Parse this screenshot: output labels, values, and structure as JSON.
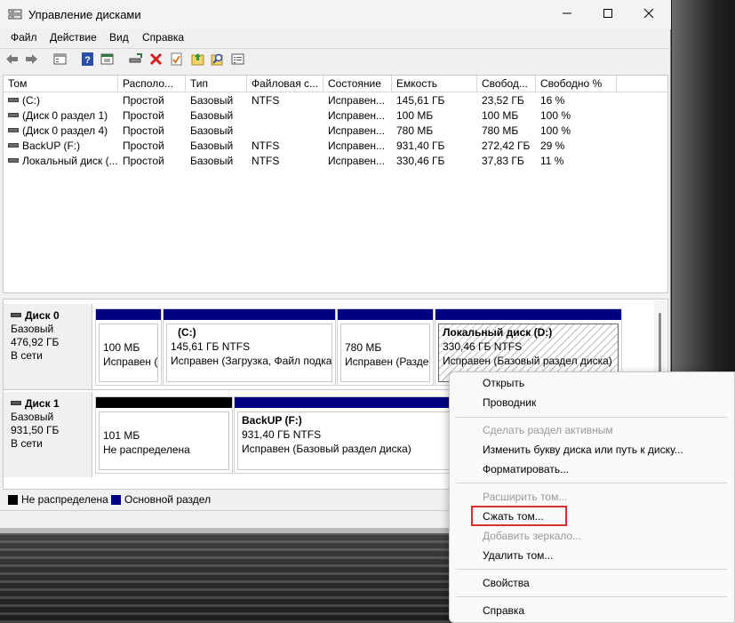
{
  "window": {
    "title": "Управление дисками",
    "controls": {
      "minimize": "—",
      "maximize": "☐",
      "close": "✕"
    }
  },
  "menu": [
    "Файл",
    "Действие",
    "Вид",
    "Справка"
  ],
  "toolbar": [
    "back-icon",
    "forward-icon",
    "properties-icon",
    "help-icon",
    "console-icon",
    "connect-icon",
    "delete-icon",
    "check-icon",
    "import-icon",
    "search-icon",
    "list-icon"
  ],
  "table": {
    "columns": [
      "Том",
      "Располо...",
      "Тип",
      "Файловая с...",
      "Состояние",
      "Емкость",
      "Свобод...",
      "Свободно %"
    ],
    "rows": [
      [
        "(C:)",
        "Простой",
        "Базовый",
        "NTFS",
        "Исправен...",
        "145,61 ГБ",
        "23,52 ГБ",
        "16 %"
      ],
      [
        "(Диск 0 раздел 1)",
        "Простой",
        "Базовый",
        "",
        "Исправен...",
        "100 МБ",
        "100 МБ",
        "100 %"
      ],
      [
        "(Диск 0 раздел 4)",
        "Простой",
        "Базовый",
        "",
        "Исправен...",
        "780 МБ",
        "780 МБ",
        "100 %"
      ],
      [
        "BackUP (F:)",
        "Простой",
        "Базовый",
        "NTFS",
        "Исправен...",
        "931,40 ГБ",
        "272,42 ГБ",
        "29 %"
      ],
      [
        "Локальный диск (...",
        "Простой",
        "Базовый",
        "NTFS",
        "Исправен...",
        "330,46 ГБ",
        "37,83 ГБ",
        "11 %"
      ]
    ]
  },
  "disks": [
    {
      "name": "Диск 0",
      "type": "Базовый",
      "size": "476,92 ГБ",
      "status": "В сети",
      "partitions": [
        {
          "title": "",
          "line1": "100 МБ",
          "line2": "Исправен (",
          "kind": "primary"
        },
        {
          "title": "(C:)",
          "line1": "145,61 ГБ NTFS",
          "line2": "Исправен (Загрузка, Файл подка",
          "kind": "primary"
        },
        {
          "title": "",
          "line1": "780 МБ",
          "line2": "Исправен (Разде",
          "kind": "primary"
        },
        {
          "title": "Локальный диск  (D:)",
          "line1": "330,46 ГБ NTFS",
          "line2": "Исправен (Базовый раздел диска)",
          "kind": "primary-selected"
        }
      ]
    },
    {
      "name": "Диск 1",
      "type": "Базовый",
      "size": "931,50 ГБ",
      "status": "В сети",
      "partitions": [
        {
          "title": "",
          "line1": "101 МБ",
          "line2": "Не распределена",
          "kind": "unallocated"
        },
        {
          "title": "BackUP  (F:)",
          "line1": "931,40 ГБ NTFS",
          "line2": "Исправен (Базовый раздел диска)",
          "kind": "primary"
        }
      ]
    }
  ],
  "legend": [
    {
      "label": "Не распределена",
      "color": "#000000"
    },
    {
      "label": "Основной раздел",
      "color": "#000080"
    }
  ],
  "context_menu": {
    "items": [
      {
        "label": "Открыть",
        "enabled": true
      },
      {
        "label": "Проводник",
        "enabled": true
      },
      {
        "label": "Сделать раздел активным",
        "enabled": false
      },
      {
        "label": "Изменить букву диска или путь к диску...",
        "enabled": true
      },
      {
        "label": "Форматировать...",
        "enabled": true
      },
      {
        "label": "Расширить том...",
        "enabled": false
      },
      {
        "label": "Сжать том...",
        "enabled": true,
        "highlighted": true
      },
      {
        "label": "Добавить зеркало...",
        "enabled": false
      },
      {
        "label": "Удалить том...",
        "enabled": true
      },
      {
        "label": "Свойства",
        "enabled": true
      },
      {
        "label": "Справка",
        "enabled": true
      }
    ]
  },
  "colors": {
    "primary": "#000080",
    "unallocated": "#000000",
    "highlight_border": "#d9312f"
  }
}
